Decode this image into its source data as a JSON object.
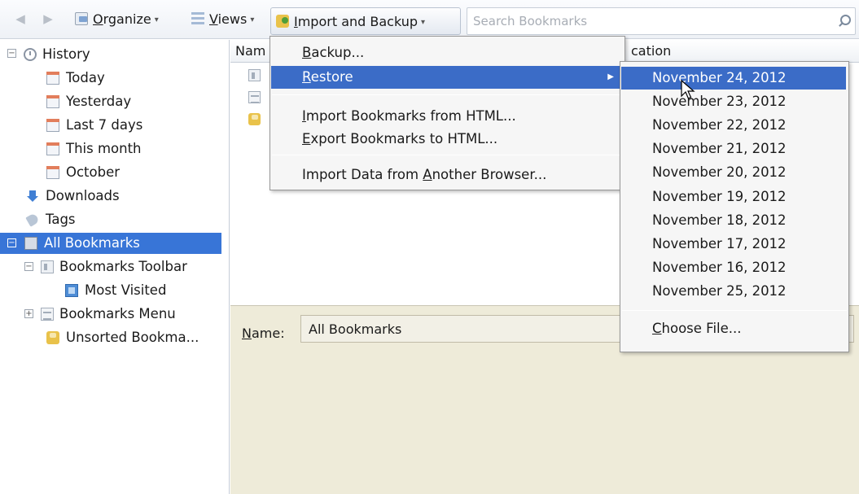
{
  "toolbar": {
    "organize": {
      "prefix": "",
      "accel": "O",
      "rest": "rganize"
    },
    "views": {
      "prefix": "",
      "accel": "V",
      "rest": "iews"
    },
    "import": {
      "prefix": "",
      "accel": "I",
      "rest": "mport and Backup"
    },
    "search_placeholder": "Search Bookmarks"
  },
  "sidebar": {
    "history": "History",
    "today": "Today",
    "yesterday": "Yesterday",
    "last7": "Last 7 days",
    "thismonth": "This month",
    "october": "October",
    "downloads": "Downloads",
    "tags": "Tags",
    "all_bookmarks": "All Bookmarks",
    "bookmarks_toolbar": "Bookmarks Toolbar",
    "most_visited": "Most Visited",
    "bookmarks_menu": "Bookmarks Menu",
    "unsorted": "Unsorted Bookma..."
  },
  "columns": {
    "name_partial": "Nam",
    "location_partial": "cation"
  },
  "details": {
    "name_label_accel": "N",
    "name_label_rest": "ame:",
    "name_value": "All Bookmarks"
  },
  "import_menu": {
    "backup": {
      "accel": "B",
      "rest": "ackup..."
    },
    "restore": {
      "accel": "R",
      "rest": "estore"
    },
    "import_html": {
      "accel": "I",
      "rest": "mport Bookmarks from HTML..."
    },
    "export_html": {
      "pre": "",
      "accel": "E",
      "rest": "xport Bookmarks to HTML..."
    },
    "import_browser": {
      "pre": "Import Data from ",
      "accel": "A",
      "rest": "nother Browser..."
    }
  },
  "restore_menu": {
    "dates": [
      "November 24, 2012",
      "November 23, 2012",
      "November 22, 2012",
      "November 21, 2012",
      "November 20, 2012",
      "November 19, 2012",
      "November 18, 2012",
      "November 17, 2012",
      "November 16, 2012",
      "November 25, 2012"
    ],
    "choose_file": {
      "accel": "C",
      "rest": "hoose File..."
    }
  },
  "colors": {
    "selection": "#3875d7",
    "menu_highlight": "#3b6cc7",
    "details_bg": "#eeebd9"
  }
}
